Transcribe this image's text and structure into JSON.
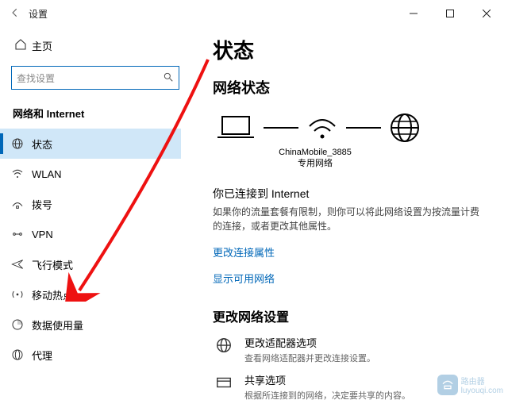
{
  "window": {
    "title": "设置"
  },
  "sidebar": {
    "home": "主页",
    "search_placeholder": "查找设置",
    "category": "网络和 Internet",
    "items": [
      {
        "key": "status",
        "label": "状态"
      },
      {
        "key": "wlan",
        "label": "WLAN"
      },
      {
        "key": "dialup",
        "label": "拨号"
      },
      {
        "key": "vpn",
        "label": "VPN"
      },
      {
        "key": "airplane",
        "label": "飞行模式"
      },
      {
        "key": "hotspot",
        "label": "移动热点"
      },
      {
        "key": "datausage",
        "label": "数据使用量"
      },
      {
        "key": "proxy",
        "label": "代理"
      }
    ]
  },
  "main": {
    "title": "状态",
    "section1_title": "网络状态",
    "net_name": "ChinaMobile_3885",
    "net_type": "专用网络",
    "connected_heading": "你已连接到 Internet",
    "connected_desc": "如果你的流量套餐有限制，则你可以将此网络设置为按流量计费的连接，或者更改其他属性。",
    "link_change_props": "更改连接属性",
    "link_show_avail": "显示可用网络",
    "section2_title": "更改网络设置",
    "opt_adapter_title": "更改适配器选项",
    "opt_adapter_sub": "查看网络适配器并更改连接设置。",
    "opt_share_title": "共享选项",
    "opt_share_sub": "根据所连接到的网络，决定要共享的内容。"
  },
  "watermark": {
    "text": "路由器",
    "url": "luyouqi.com"
  }
}
